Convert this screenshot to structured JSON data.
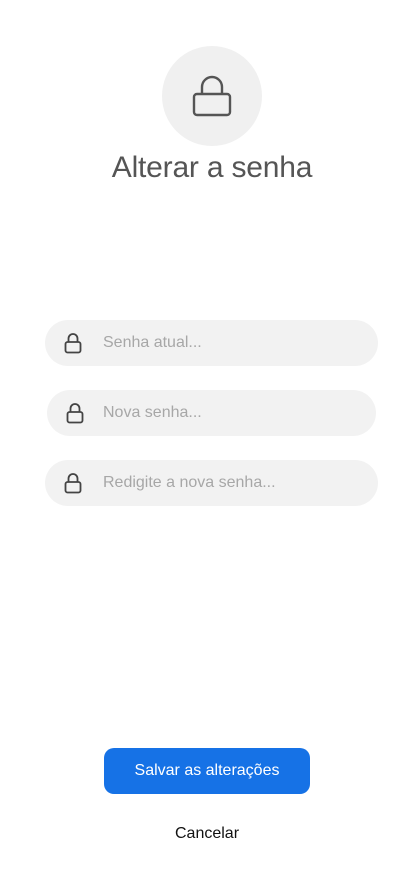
{
  "header": {
    "title": "Alterar a senha",
    "icon": "lock-icon"
  },
  "form": {
    "fields": [
      {
        "name": "current-password",
        "placeholder": "Senha atual...",
        "value": "",
        "icon": "lock-icon"
      },
      {
        "name": "new-password",
        "placeholder": "Nova senha...",
        "value": "",
        "icon": "lock-icon"
      },
      {
        "name": "confirm-password",
        "placeholder": "Redigite a nova senha...",
        "value": "",
        "icon": "lock-icon"
      }
    ]
  },
  "actions": {
    "save_label": "Salvar as alterações",
    "cancel_label": "Cancelar"
  },
  "colors": {
    "accent": "#1672e6",
    "field_background": "#f2f2f2",
    "title": "#555555"
  }
}
